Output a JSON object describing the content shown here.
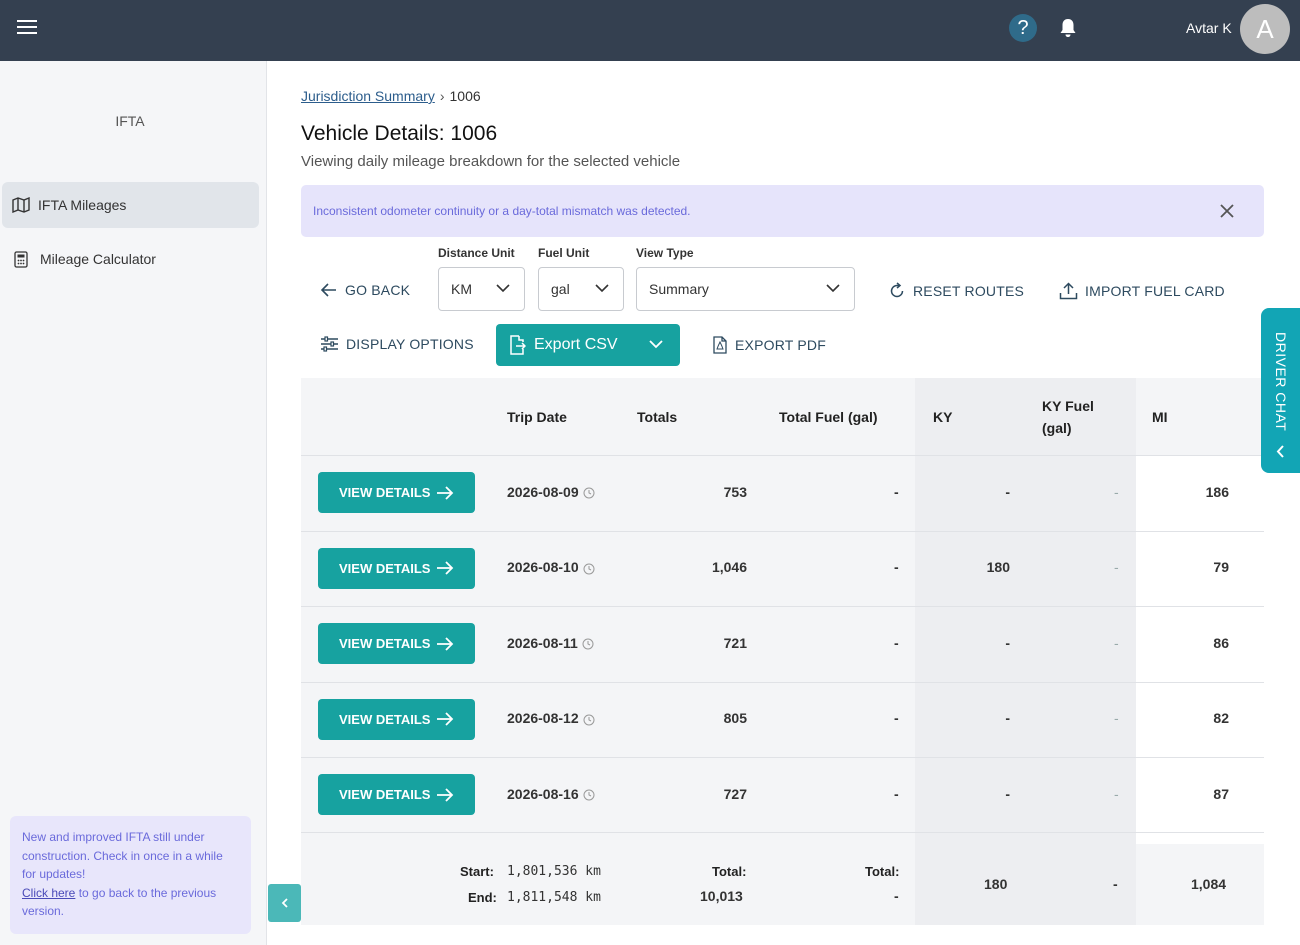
{
  "topbar": {
    "help_symbol": "?",
    "user_name": "Avtar K",
    "avatar_initial": "A"
  },
  "sidebar": {
    "title": "IFTA",
    "items": [
      {
        "label": "IFTA Mileages",
        "icon": "map-icon",
        "active": true
      },
      {
        "label": "Mileage Calculator",
        "icon": "calculator-icon",
        "active": false
      }
    ],
    "notice": {
      "text": "New and improved IFTA still under construction. Check in once in a while for updates!",
      "link": "Click here",
      "link_suffix": " to go back to the previous version."
    }
  },
  "breadcrumb": {
    "parent": "Jurisdiction Summary",
    "separator": "›",
    "current": "1006"
  },
  "page": {
    "title": "Vehicle Details: 1006",
    "subtitle": "Viewing daily mileage breakdown for the selected vehicle"
  },
  "alert": {
    "text": "Inconsistent odometer continuity or a day-total mismatch was detected."
  },
  "toolbar": {
    "go_back": "GO BACK",
    "distance_unit_label": "Distance Unit",
    "distance_unit_value": "KM",
    "fuel_unit_label": "Fuel Unit",
    "fuel_unit_value": "gal",
    "view_type_label": "View Type",
    "view_type_value": "Summary",
    "reset_routes": "RESET ROUTES",
    "import_fuel_card": "IMPORT FUEL CARD",
    "display_options": "DISPLAY OPTIONS",
    "export_csv": "Export CSV",
    "export_pdf": "EXPORT PDF"
  },
  "table": {
    "headers": {
      "trip_date": "Trip Date",
      "totals": "Totals",
      "total_fuel": "Total Fuel (gal)",
      "ky": "KY",
      "ky_fuel_line1": "KY Fuel",
      "ky_fuel_line2": "(gal)",
      "mi": "MI"
    },
    "view_details_label": "VIEW DETAILS",
    "rows": [
      {
        "date": "2026-08-09",
        "totals": "753",
        "total_fuel": "-",
        "ky": "-",
        "ky_fuel": "-",
        "mi": "186"
      },
      {
        "date": "2026-08-10",
        "totals": "1,046",
        "total_fuel": "-",
        "ky": "180",
        "ky_fuel": "-",
        "mi": "79"
      },
      {
        "date": "2026-08-11",
        "totals": "721",
        "total_fuel": "-",
        "ky": "-",
        "ky_fuel": "-",
        "mi": "86"
      },
      {
        "date": "2026-08-12",
        "totals": "805",
        "total_fuel": "-",
        "ky": "-",
        "ky_fuel": "-",
        "mi": "82"
      },
      {
        "date": "2026-08-16",
        "totals": "727",
        "total_fuel": "-",
        "ky": "-",
        "ky_fuel": "-",
        "mi": "87"
      }
    ],
    "footer": {
      "start_label": "Start:",
      "start_value": "1,801,536 km",
      "end_label": "End:",
      "end_value": "1,811,548 km",
      "totals_label": "Total:",
      "totals_value": "10,013",
      "fuel_label": "Total:",
      "fuel_value": "-",
      "ky": "180",
      "ky_fuel": "-",
      "mi": "1,084"
    }
  },
  "driver_chat": {
    "label": "DRIVER CHAT"
  },
  "colors": {
    "topbar": "#344050",
    "accent_teal": "#17a2a0",
    "alert_bg": "#e6e4fb",
    "alert_text": "#6a6adb"
  }
}
